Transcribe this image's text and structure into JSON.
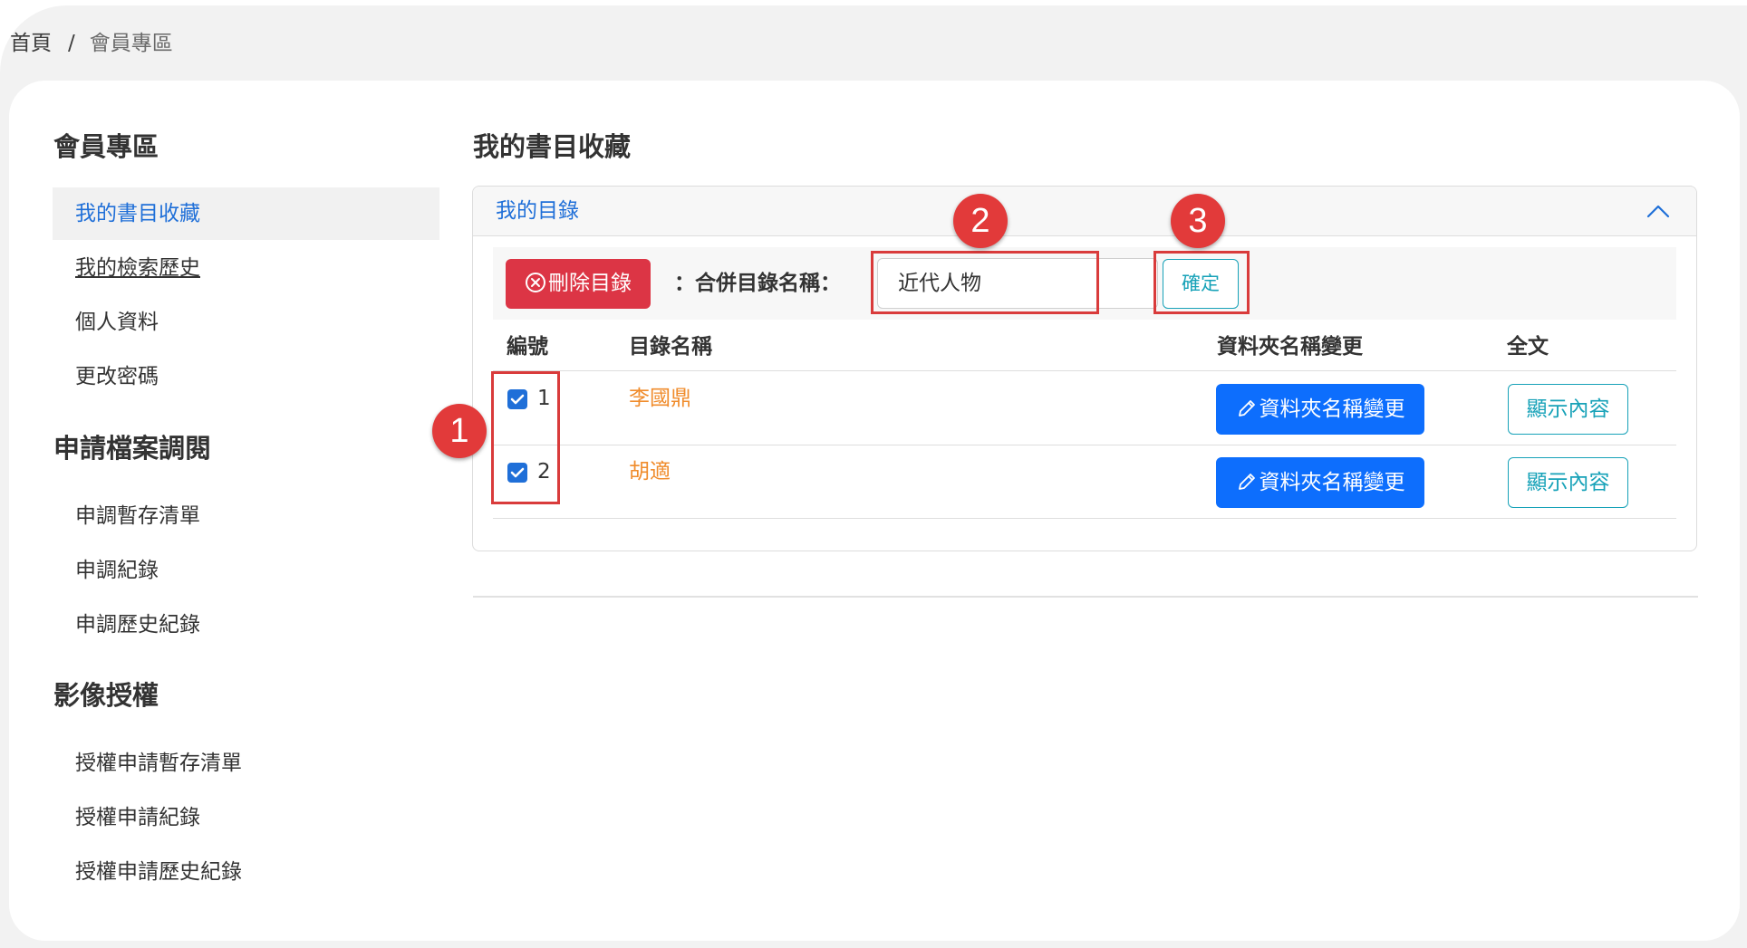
{
  "breadcrumb": {
    "home": "首頁",
    "separator": "/",
    "current": "會員專區"
  },
  "sidebar": {
    "sections": [
      {
        "heading": "會員專區",
        "items": [
          {
            "label": "我的書目收藏",
            "active": true
          },
          {
            "label": "我的檢索歷史"
          },
          {
            "label": "個人資料"
          },
          {
            "label": "更改密碼"
          }
        ]
      },
      {
        "heading": "申請檔案調閱",
        "items": [
          {
            "label": "申調暫存清單"
          },
          {
            "label": "申調紀錄"
          },
          {
            "label": "申調歷史紀錄"
          }
        ]
      },
      {
        "heading": "影像授權",
        "items": [
          {
            "label": "授權申請暫存清單"
          },
          {
            "label": "授權申請紀錄"
          },
          {
            "label": "授權申請歷史紀錄"
          }
        ]
      }
    ]
  },
  "main": {
    "title": "我的書目收藏",
    "card": {
      "header": "我的目錄",
      "toolbar": {
        "delete_label": "刪除目錄",
        "merge_label": "：合併目錄名稱：",
        "merge_value": "近代人物",
        "confirm_label": "確定"
      },
      "table": {
        "columns": [
          "編號",
          "目錄名稱",
          "資料夾名稱變更",
          "全文"
        ],
        "rows": [
          {
            "num": "1",
            "name": "李國鼎",
            "checked": true,
            "rename_label": "資料夾名稱變更",
            "show_label": "顯示內容"
          },
          {
            "num": "2",
            "name": "胡適",
            "checked": true,
            "rename_label": "資料夾名稱變更",
            "show_label": "顯示內容"
          }
        ]
      }
    }
  },
  "annotations": {
    "markers": [
      "1",
      "2",
      "3"
    ]
  },
  "colors": {
    "link_blue": "#1f6fd8",
    "danger": "#dc3545",
    "primary": "#0d6efd",
    "info": "#17a2b8",
    "orange_text": "#f08c2c",
    "annotation_red": "#e23a3a"
  }
}
